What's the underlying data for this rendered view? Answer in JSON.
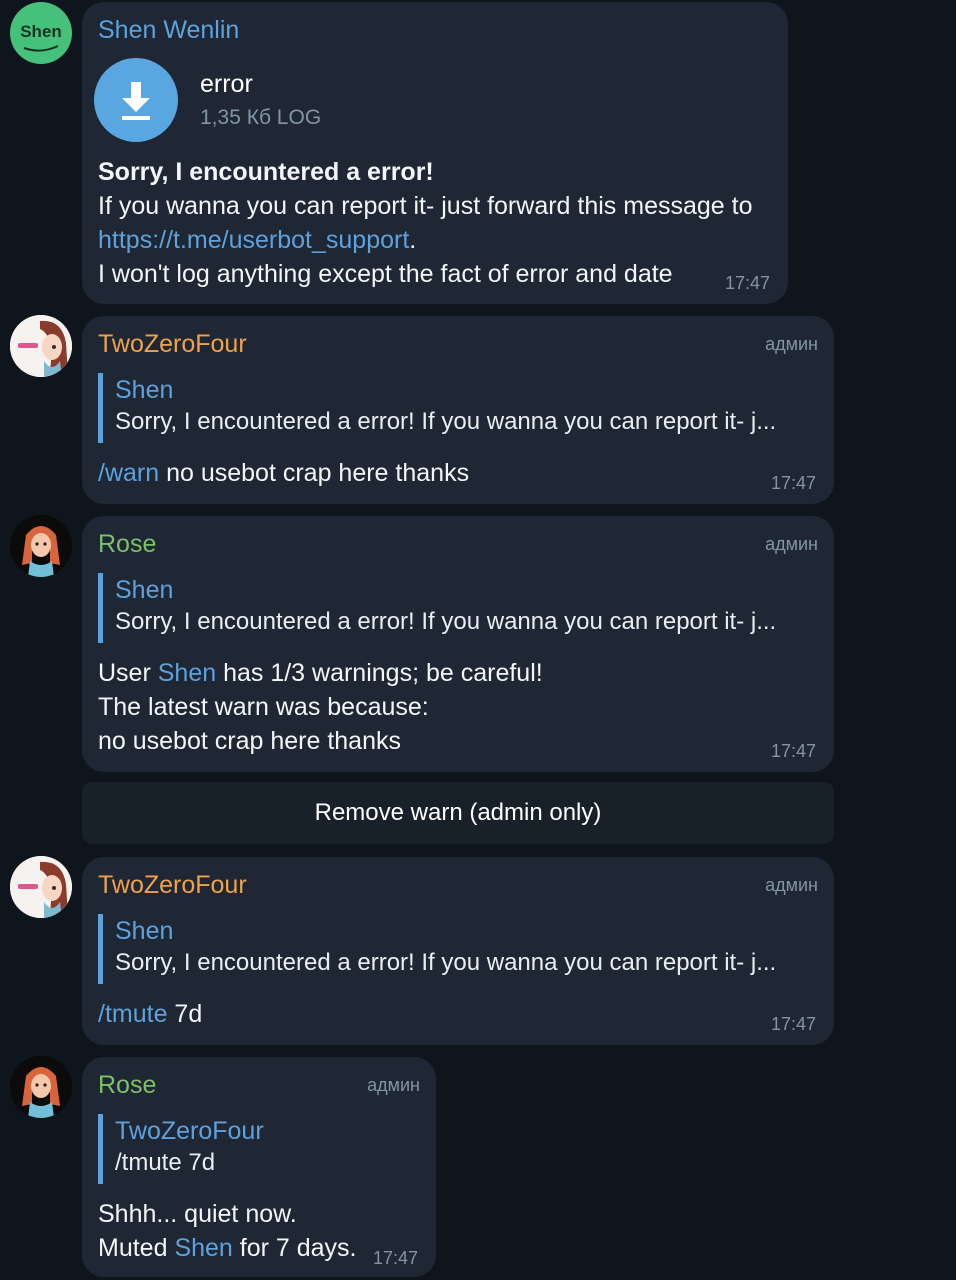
{
  "messages": [
    {
      "avatar_text": "Shen",
      "sender": "Shen Wenlin",
      "file": {
        "name": "error",
        "size": "1,35 Кб LOG",
        "icon": "download-icon"
      },
      "lines": {
        "bold": "Sorry, I encountered a error!",
        "line2": "If you wanna you can report it- just forward this message to",
        "link": "https://t.me/userbot_support",
        "link_suffix": ".",
        "line4": "I won't log anything except the fact of error and date"
      },
      "time": "17:47"
    },
    {
      "sender": "TwoZeroFour",
      "badge": "админ",
      "reply": {
        "name": "Shen",
        "text": "Sorry, I encountered a error! If you wanna you can report it- j..."
      },
      "command": "/warn",
      "text": " no usebot crap here thanks",
      "time": "17:47"
    },
    {
      "sender": "Rose",
      "badge": "админ",
      "reply": {
        "name": "Shen",
        "text": "Sorry, I encountered a error! If you wanna you can report it- j..."
      },
      "lines": {
        "l1_pre": "User ",
        "l1_mention": "Shen",
        "l1_post": " has 1/3 warnings; be careful!",
        "l2": "The latest warn was because:",
        "l3": "no usebot crap here thanks"
      },
      "time": "17:47"
    },
    {
      "sender": "TwoZeroFour",
      "badge": "админ",
      "reply": {
        "name": "Shen",
        "text": "Sorry, I encountered a error! If you wanna you can report it- j..."
      },
      "command": "/tmute",
      "text": " 7d",
      "time": "17:47"
    },
    {
      "sender": "Rose",
      "badge": "админ",
      "reply": {
        "name": "TwoZeroFour",
        "text": "/tmute 7d"
      },
      "lines": {
        "l1": "Shhh... quiet now.",
        "l2_pre": "Muted ",
        "l2_mention": "Shen",
        "l2_post": " for 7 days."
      },
      "time": "17:47"
    }
  ],
  "inline_button": {
    "label": "Remove warn (admin only)"
  },
  "colors": {
    "background": "#0f151d",
    "bubble": "#1e2733",
    "link": "#5da2dd",
    "sender_shen": "#5da2dd",
    "sender_twozerofour": "#f0a24a",
    "sender_rose": "#7cc06a",
    "meta": "#8394a6"
  }
}
